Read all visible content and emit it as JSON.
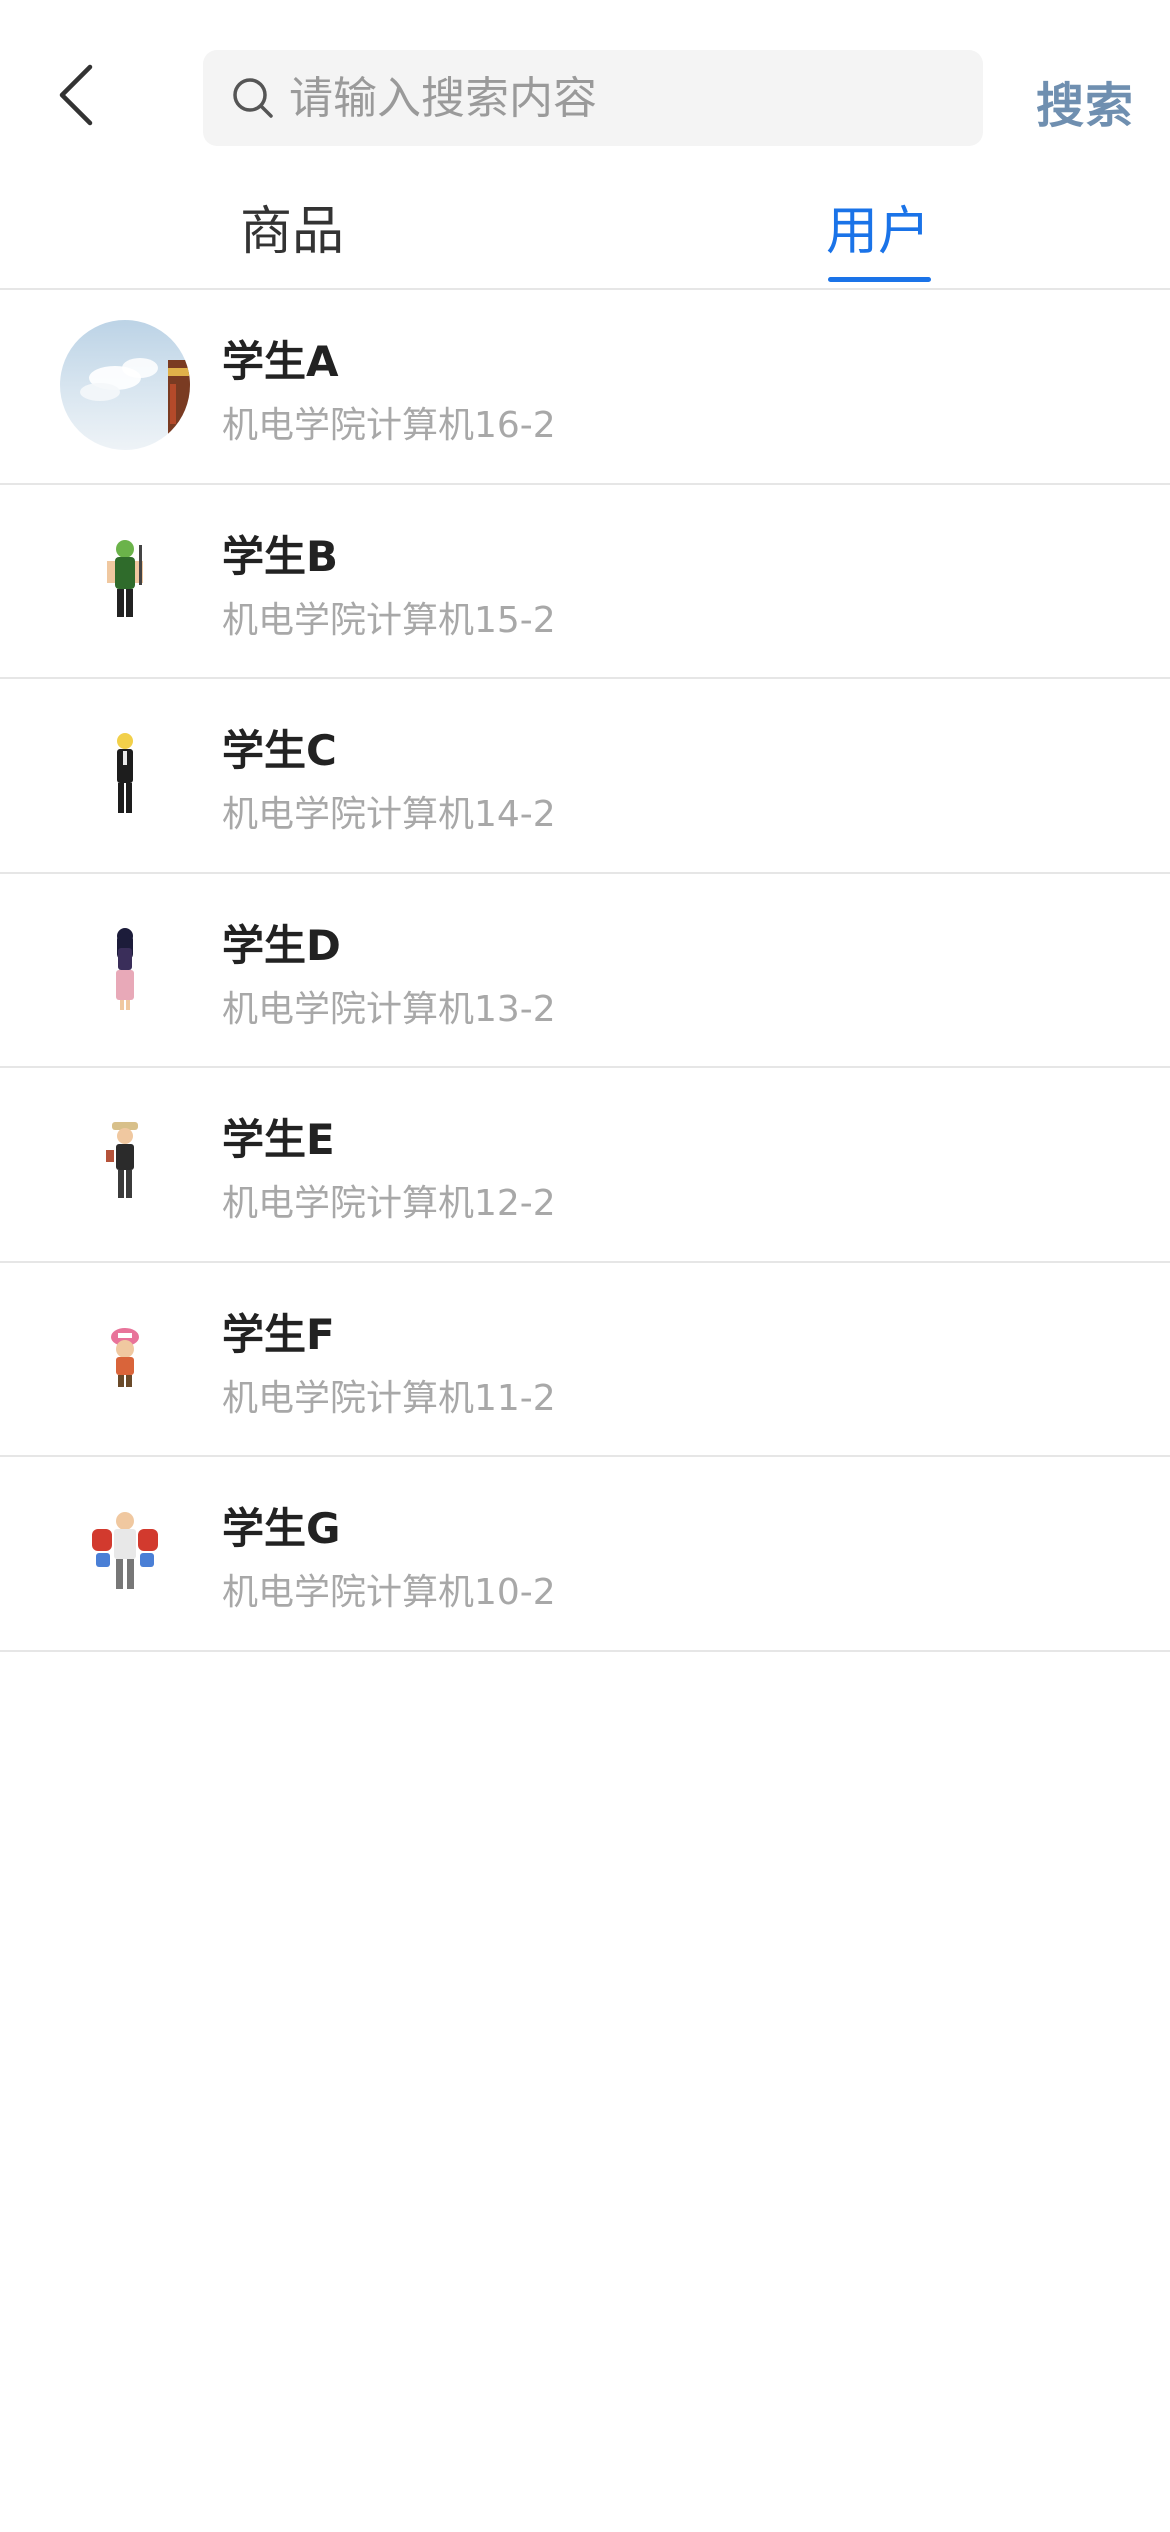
{
  "header": {
    "search_placeholder": "请输入搜索内容",
    "search_value": "",
    "search_label": "搜索"
  },
  "tabs": [
    {
      "label": "商品",
      "active": false
    },
    {
      "label": "用户",
      "active": true
    }
  ],
  "colors": {
    "accent": "#1a73e8",
    "search_button": "#6f8fb0",
    "secondary_text": "#a8a8a8",
    "divider": "#e6e6e6"
  },
  "users": [
    {
      "name": "学生A",
      "info": "机电学院计算机16-2",
      "avatar": "sky-scene-avatar"
    },
    {
      "name": "学生B",
      "info": "机电学院计算机15-2",
      "avatar": "swordsman-character-avatar"
    },
    {
      "name": "学生C",
      "info": "机电学院计算机14-2",
      "avatar": "suit-character-avatar"
    },
    {
      "name": "学生D",
      "info": "机电学院计算机13-2",
      "avatar": "dark-hair-character-avatar"
    },
    {
      "name": "学生E",
      "info": "机电学院计算机12-2",
      "avatar": "hat-character-avatar"
    },
    {
      "name": "学生F",
      "info": "机电学院计算机11-2",
      "avatar": "reindeer-character-avatar"
    },
    {
      "name": "学生G",
      "info": "机电学院计算机10-2",
      "avatar": "robot-character-avatar"
    }
  ]
}
